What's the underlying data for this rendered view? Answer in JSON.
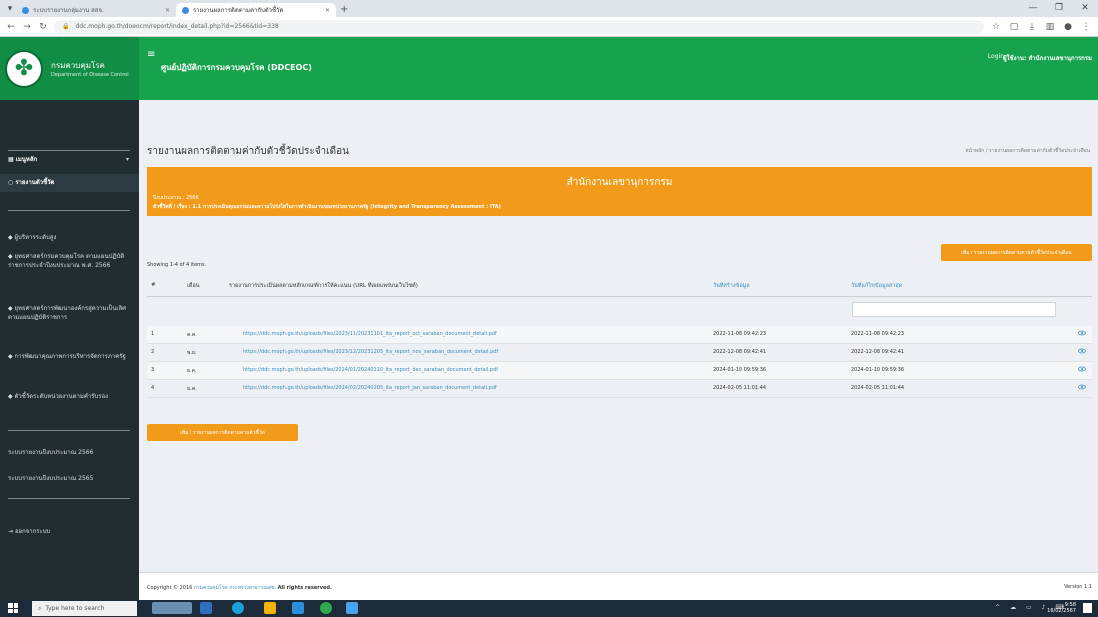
{
  "browser": {
    "tabs": [
      {
        "label": "ระบบรายงานกลุ่มงาน สสจ."
      },
      {
        "label": "รายงานผลการติดตามค่ากับตัวชี้วัด"
      }
    ],
    "url": "ddc.moph.go.th/doeocm/report/index_detail.php?id=2566&tid=338"
  },
  "header": {
    "logo_line1": "กรมควบคุมโรค",
    "logo_line2": "Department of Disease Control",
    "brand": "ศูนย์ปฏิบัติการกรมควบคุมโรค (DDCEOC)",
    "login": "Login",
    "org": "ผู้ใช้งาน: สำนักงานเลขานุการกรม"
  },
  "sidebar": {
    "main_menu": "เมนูหลัก",
    "main_sub": "รายงานตัวชี้วัด",
    "items": [
      "ผู้บริหารระดับสูง",
      "ยุทธศาสตร์กรมควบคุมโรค ตามแผนปฏิบัติราชการประจำปีงบประมาณ พ.ศ. 2566",
      "ยุทธศาสตร์การพัฒนาองค์กรสู่ความเป็นเลิศตามแผนปฏิบัติราชการ",
      "การพัฒนาคุณภาพการบริหารจัดการภาครัฐ",
      "ตัวชี้วัดระดับหน่วยงานตามคำรับรอง"
    ],
    "years": [
      "ระบบรายงานปีงบประมาณ 2566",
      "ระบบรายงานปีงบประมาณ 2565"
    ],
    "logout": "ออกจากระบบ"
  },
  "page": {
    "title": "รายงานผลการติดตามค่ากับตัวชี้วัดประจำเดือน",
    "breadcrumb": "หน้าหลัก / รายงานผลการติดตามค่ากับตัวชี้วัดประจำเดือน"
  },
  "banner": {
    "title": "สำนักงานเลขานุการกรม",
    "line1": "ปีงบประมาณ : 2566",
    "line2": "ตัวชี้วัดที่ / เรื่อง : 1.1 การประเมินคุณธรรมและความโปร่งใสในการดำเนินงานของหน่วยงานภาครัฐ (Integrity and Transparency Assessment : ITA)"
  },
  "buttons": {
    "add_top": "เพิ่ม / รายงานผลการติดตามตามตัวชี้วัดประจำเดือน",
    "add_bottom": "เพิ่ม / รายงานผลการติดตามตามตัวชี้วัด"
  },
  "table": {
    "showing": "Showing 1-4 of 4 items.",
    "headers": [
      "#",
      "เดือน",
      "รายงานการประเมินผลตามหลักเกณฑ์การให้คะแนน (URL ที่เผยแพร่บนเว็บไซต์)",
      "วันที่สร้างข้อมูล",
      "วันที่แก้ไขข้อมูลล่าสุด"
    ],
    "rows": [
      {
        "num": "1",
        "month": "ต.ค.",
        "url": "https://ddc.moph.go.th/uploads/files/2023/11/20231101_ita_report_oct_saraban_document_detail.pdf",
        "created": "2022-11-08 09:42:23",
        "updated": "2022-11-08 09:42:23"
      },
      {
        "num": "2",
        "month": "พ.ย.",
        "url": "https://ddc.moph.go.th/uploads/files/2023/12/20231205_ita_report_nov_saraban_document_detail.pdf",
        "created": "2022-12-08 09:42:41",
        "updated": "2022-12-08 09:42:41"
      },
      {
        "num": "3",
        "month": "ธ.ค.",
        "url": "https://ddc.moph.go.th/uploads/files/2024/01/20240110_ita_report_dec_saraban_document_detail.pdf",
        "created": "2024-01-10 09:59:36",
        "updated": "2024-01-10 09:59:36"
      },
      {
        "num": "4",
        "month": "ม.ค.",
        "url": "https://ddc.moph.go.th/uploads/files/2024/02/20240205_ita_report_jan_saraban_document_detail.pdf",
        "created": "2024-02-05 11:01:44",
        "updated": "2024-02-05 11:01:44"
      }
    ]
  },
  "footer": {
    "copyright_prefix": "Copyright © 2016",
    "copyright_org": "กรมควบคุมโรค กระทรวงสาธารณสุข",
    "copyright_suffix": "All rights reserved.",
    "version": "Version 1.1"
  },
  "taskbar": {
    "search_placeholder": "Type here to search",
    "time": "9:58",
    "date": "16/02/2567"
  }
}
